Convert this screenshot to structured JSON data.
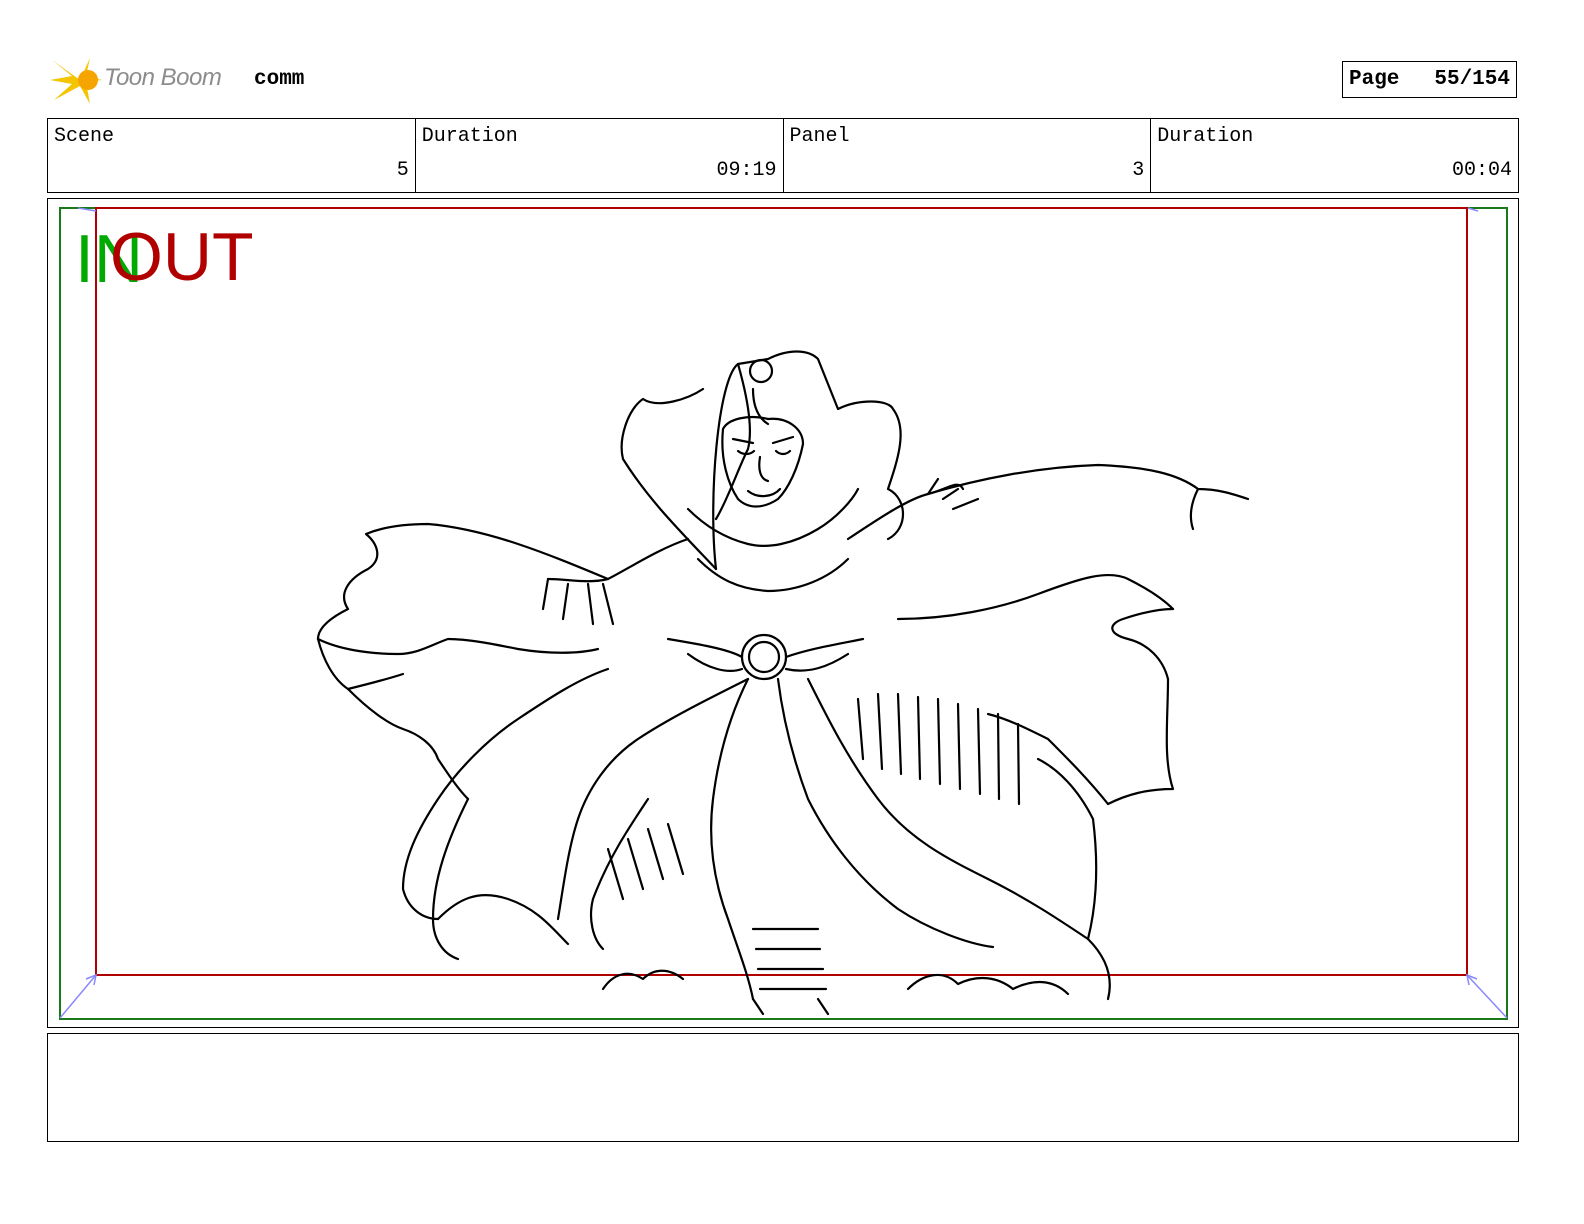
{
  "header": {
    "logo_text": "Toon Boom",
    "project": "comm",
    "page_label": "Page",
    "page_value": "55/154"
  },
  "info": [
    {
      "label": "Scene",
      "value": "5"
    },
    {
      "label": "Duration",
      "value": "09:19"
    },
    {
      "label": "Panel",
      "value": "3"
    },
    {
      "label": "Duration",
      "value": "00:04"
    }
  ],
  "panel": {
    "in_label": "IN",
    "out_label": "OUT",
    "in_color": "#00aa00",
    "out_color": "#b00000",
    "illustration": "sketch"
  },
  "notes": {
    "text": ""
  }
}
